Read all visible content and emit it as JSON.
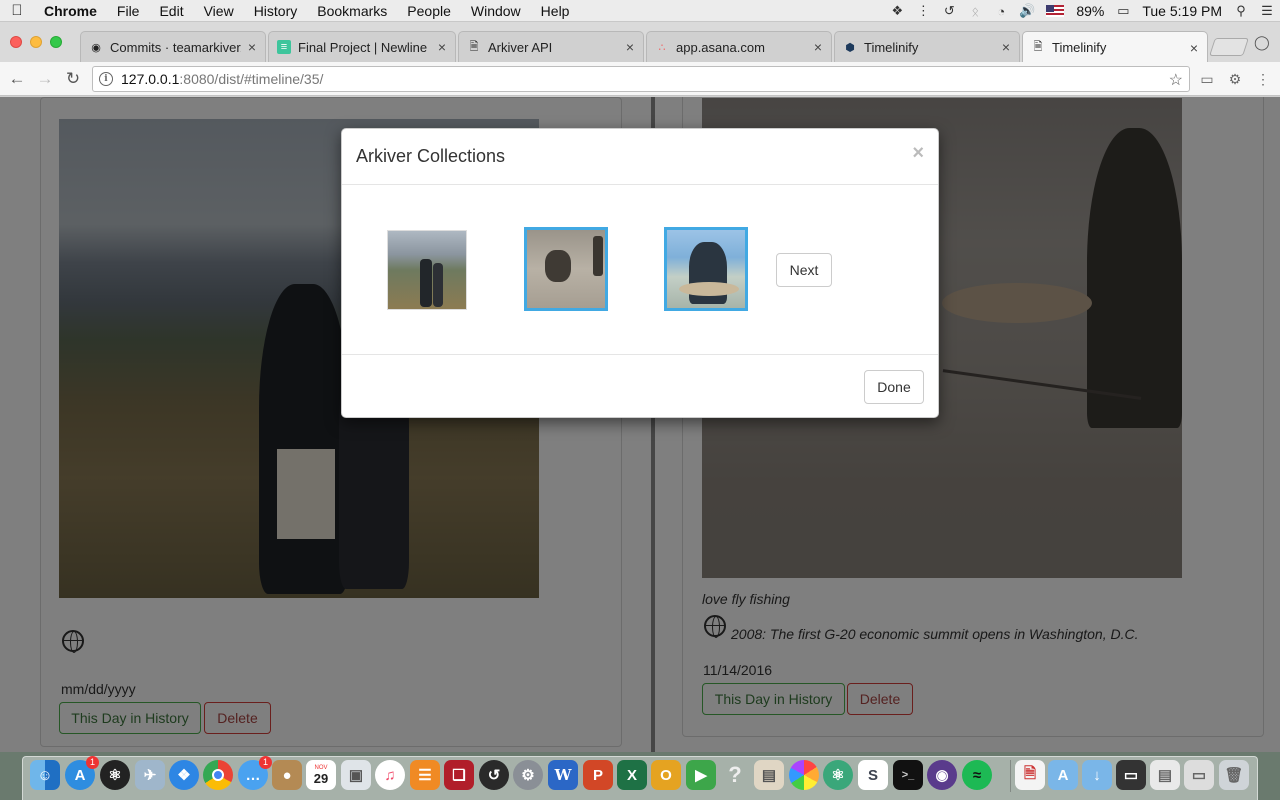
{
  "menubar": {
    "app_name": "Chrome",
    "items": [
      "File",
      "Edit",
      "View",
      "History",
      "Bookmarks",
      "People",
      "Window",
      "Help"
    ],
    "battery": "89%",
    "clock": "Tue 5:19 PM"
  },
  "tabs": [
    {
      "title": "Commits · teamarkiver/",
      "icon": "github-icon"
    },
    {
      "title": "Final Project | Newline",
      "icon": "newline-icon"
    },
    {
      "title": "Arkiver API",
      "icon": "page-icon"
    },
    {
      "title": "app.asana.com",
      "icon": "asana-icon"
    },
    {
      "title": "Timelinify",
      "icon": "timelinify-icon"
    },
    {
      "title": "Timelinify",
      "icon": "page-icon",
      "active": true
    }
  ],
  "address_bar": {
    "host": "127.0.0.1",
    "path": ":8080/dist/#timeline/35/"
  },
  "left_card": {
    "date": "mm/dd/yyyy",
    "history_button": "This Day in History",
    "delete_button": "Delete"
  },
  "right_card": {
    "caption": "love fly fishing",
    "history_fact": "2008: The first G-20 economic summit opens in Washington, D.C.",
    "date": "11/14/2016",
    "history_button": "This Day in History",
    "delete_button": "Delete"
  },
  "modal": {
    "title": "Arkiver Collections",
    "close_glyph": "×",
    "next_button": "Next",
    "done_button": "Done",
    "thumbnails": [
      {
        "subject": "couple-mountain-photo",
        "selected": false
      },
      {
        "subject": "fly-fishing-photo",
        "selected": true
      },
      {
        "subject": "fish-catch-photo",
        "selected": true
      }
    ]
  },
  "dock": {
    "app_store_badge": "1",
    "messages_badge": "1",
    "calendar_day": "29",
    "calendar_month": "NOV"
  },
  "colors": {
    "selected_border": "#41a9e3",
    "success": "#4cae4c",
    "danger": "#d43f3a"
  }
}
